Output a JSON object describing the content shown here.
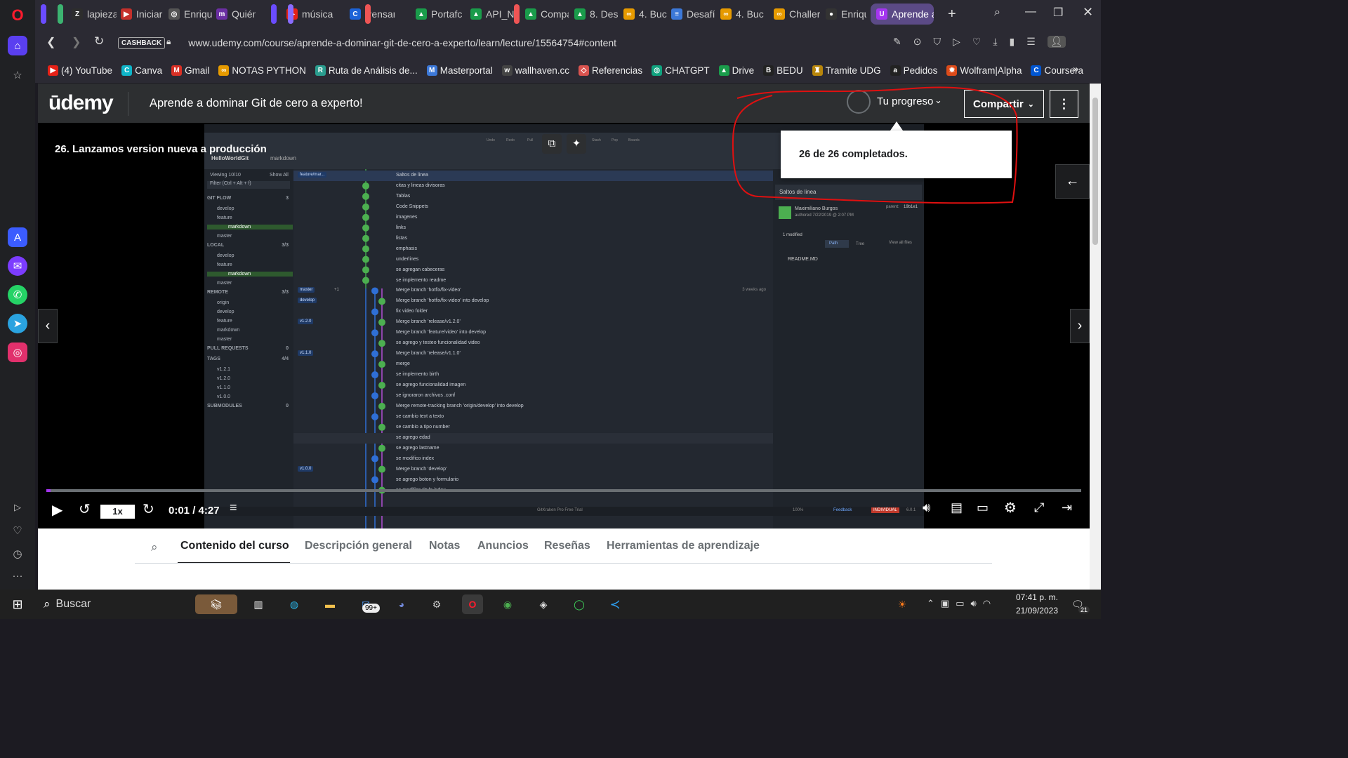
{
  "browser": {
    "tabs": [
      {
        "label": "lapieza",
        "icon": "Z",
        "color": "#2d2d2d"
      },
      {
        "label": "Iniciar",
        "icon": "▶",
        "color": "#c4302b"
      },
      {
        "label": "Enriqu",
        "icon": "◎",
        "color": "#555"
      },
      {
        "label": "Quién",
        "icon": "m",
        "color": "#6b2fa3"
      },
      {
        "label": "música",
        "icon": "▶",
        "color": "#e62117"
      },
      {
        "label": "Pensan",
        "icon": "C",
        "color": "#1c63d8"
      },
      {
        "label": "Portafc",
        "icon": "▲",
        "color": "#1a9c4b"
      },
      {
        "label": "API_N/",
        "icon": "▲",
        "color": "#1a9c4b"
      },
      {
        "label": "Compa",
        "icon": "▲",
        "color": "#1a9c4b"
      },
      {
        "label": "8. Desa",
        "icon": "▲",
        "color": "#1a9c4b"
      },
      {
        "label": "4. Bucl",
        "icon": "∞",
        "color": "#e69a00"
      },
      {
        "label": "Desafío",
        "icon": "≡",
        "color": "#3c78d8"
      },
      {
        "label": "4. Bucl",
        "icon": "∞",
        "color": "#e69a00"
      },
      {
        "label": "Challer",
        "icon": "∞",
        "color": "#e69a00"
      },
      {
        "label": "Enriqu",
        "icon": "●",
        "color": "#333"
      },
      {
        "label": "Aprende a do",
        "icon": "U",
        "color": "#a435f0"
      }
    ],
    "url": "www.udemy.com/course/aprende-a-dominar-git-de-cero-a-experto/learn/lecture/15564754#content",
    "cashback": "CASHBACK",
    "bookmarks": [
      {
        "label": "(4) YouTube",
        "icon": "▶",
        "color": "#e62117"
      },
      {
        "label": "Canva",
        "icon": "C",
        "color": "#0fb5c9"
      },
      {
        "label": "Gmail",
        "icon": "M",
        "color": "#d93025"
      },
      {
        "label": "NOTAS PYTHON",
        "icon": "∞",
        "color": "#e69a00"
      },
      {
        "label": "Ruta de Análisis de...",
        "icon": "R",
        "color": "#2a9d8f"
      },
      {
        "label": "Masterportal",
        "icon": "M",
        "color": "#3c78d8"
      },
      {
        "label": "wallhaven.cc",
        "icon": "w",
        "color": "#444"
      },
      {
        "label": "Referencias",
        "icon": "◇",
        "color": "#d9534f"
      },
      {
        "label": "CHATGPT",
        "icon": "◎",
        "color": "#10a37f"
      },
      {
        "label": "Drive",
        "icon": "▲",
        "color": "#1a9c4b"
      },
      {
        "label": "BEDU",
        "icon": "B",
        "color": "#222"
      },
      {
        "label": "Tramite UDG",
        "icon": "♜",
        "color": "#b8860b"
      },
      {
        "label": "Pedidos",
        "icon": "a",
        "color": "#222"
      },
      {
        "label": "Wolfram|Alpha",
        "icon": "✹",
        "color": "#dd4b1a"
      },
      {
        "label": "Coursera",
        "icon": "C",
        "color": "#0056d2"
      }
    ]
  },
  "udemy": {
    "logo": "ūdemy",
    "course_title": "Aprende a dominar Git de cero a experto!",
    "progress_label": "Tu progreso",
    "progress_fraction": 1.0,
    "share_label": "Compartir",
    "popover_text": "26 de 26 completados.",
    "lecture_title": "26. Lanzamos version nueva a producción",
    "time": "0:01 / 4:27",
    "speed": "1x",
    "video_progress": 0.004,
    "course_tabs": [
      "Contenido del curso",
      "Descripción general",
      "Notas",
      "Anuncios",
      "Reseñas",
      "Herramientas de aprendizaje"
    ]
  },
  "gitkraken": {
    "repo": "HelloWorldGit",
    "branch": "markdown",
    "viewing": "Viewing 10/10",
    "show_all": "Show All",
    "filter_placeholder": "Filter (Ctrl + Alt + f)",
    "toolbar": [
      "Undo",
      "Redo",
      "Pull",
      "Push",
      "Branch",
      "Stash",
      "Pop",
      "Boards"
    ],
    "left_nav": [
      {
        "label": "GIT FLOW",
        "count": "3",
        "section": true
      },
      {
        "label": "develop"
      },
      {
        "label": "feature"
      },
      {
        "label": "markdown",
        "highlight": true
      },
      {
        "label": "master"
      },
      {
        "label": "LOCAL",
        "count": "3/3",
        "section": true
      },
      {
        "label": "develop"
      },
      {
        "label": "feature"
      },
      {
        "label": "markdown",
        "highlight": true
      },
      {
        "label": "master"
      },
      {
        "label": "REMOTE",
        "count": "3/3",
        "section": true
      },
      {
        "label": "origin"
      },
      {
        "label": "develop"
      },
      {
        "label": "feature"
      },
      {
        "label": "markdown"
      },
      {
        "label": "master"
      },
      {
        "label": "PULL REQUESTS",
        "count": "0",
        "section": true
      },
      {
        "label": "TAGS",
        "count": "4/4",
        "section": true
      },
      {
        "label": "v1.2.1"
      },
      {
        "label": "v1.2.0"
      },
      {
        "label": "v1.1.0"
      },
      {
        "label": "v1.0.0"
      },
      {
        "label": "SUBMODULES",
        "count": "0",
        "section": true
      }
    ],
    "commits": [
      {
        "msg": "Saltos de linea",
        "ref": "feature/mar..."
      },
      {
        "msg": "citas y lineas divisoras"
      },
      {
        "msg": "Tablas"
      },
      {
        "msg": "Code Snippets"
      },
      {
        "msg": "imagenes"
      },
      {
        "msg": "links"
      },
      {
        "msg": "listas"
      },
      {
        "msg": "emphasis"
      },
      {
        "msg": "underlines"
      },
      {
        "msg": "se agregan cabeceras"
      },
      {
        "msg": "se implemento readme"
      },
      {
        "msg": "Merge branch 'hotfix/fix-video'",
        "ref": "master",
        "extra": "+1",
        "time": "3 weeks ago"
      },
      {
        "msg": "Merge branch 'hotfix/fix-video' into develop",
        "ref": "develop"
      },
      {
        "msg": "fix video folder"
      },
      {
        "msg": "Merge branch 'release/v1.2.0'",
        "ref": "v1.2.0"
      },
      {
        "msg": "Merge branch 'feature/video' into develop"
      },
      {
        "msg": "se agrego y testeo funcionalidad video"
      },
      {
        "msg": "Merge branch 'release/v1.1.0'",
        "ref": "v1.1.0"
      },
      {
        "msg": "merge"
      },
      {
        "msg": "se implemento birth"
      },
      {
        "msg": "se agrego funcionalidad imagen"
      },
      {
        "msg": "se ignoraron archivos .conf"
      },
      {
        "msg": "Merge remote-tracking branch 'origin/develop' into develop"
      },
      {
        "msg": "se cambio text a texto"
      },
      {
        "msg": "se cambio a tipo number"
      },
      {
        "msg": "se agrego edad"
      },
      {
        "msg": "se agrego lastname"
      },
      {
        "msg": "se modifico index"
      },
      {
        "msg": "Merge branch 'develop'",
        "ref": "v1.0.0"
      },
      {
        "msg": "se agrego boton y formulario"
      },
      {
        "msg": "se modifico titulo index"
      }
    ],
    "details": {
      "title": "Saltos de linea",
      "author": "Maximiliano Burgos",
      "authored": "authored 7/22/2019 @ 2:07 PM",
      "parent_label": "parent:",
      "parent": "19b1e1",
      "modified": "1 modified",
      "path": "Path",
      "tree": "Tree",
      "view_all": "View all files",
      "file": "README.MD"
    },
    "status_left": "GitKraken Pro Free Trial",
    "status_right": [
      "100%",
      "Feedback",
      "INDIVIDUAL",
      "6.0.1"
    ]
  },
  "taskbar": {
    "search": "Buscar",
    "mail_badge": "99+",
    "time": "07:41 p. m.",
    "date": "21/09/2023",
    "notif_count": "21"
  }
}
